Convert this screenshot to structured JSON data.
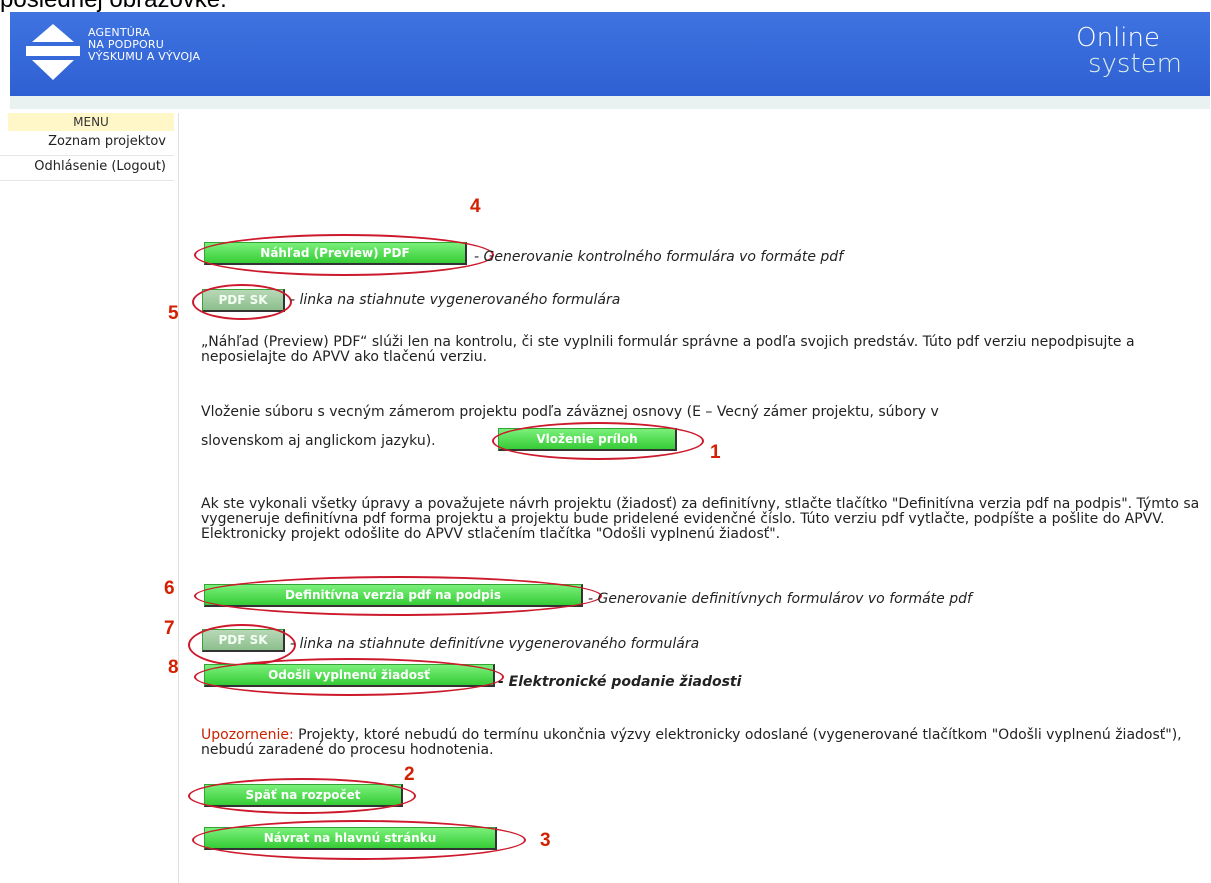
{
  "caption": "poslednej obrazovke.",
  "header": {
    "logo_lines": [
      "AGENTÚRA",
      "NA PODPORU",
      "VÝSKUMU A VÝVOJA"
    ],
    "brand_line1": "Online",
    "brand_line2": "system"
  },
  "sidebar": {
    "title": "MENU",
    "items": [
      {
        "label": "Zoznam projektov"
      },
      {
        "label": "Odhlásenie (Logout)"
      }
    ]
  },
  "buttons": {
    "preview_pdf": "Náhľad (Preview) PDF",
    "pdf_sk": "PDF SK",
    "upload_attachments": "Vloženie príloh",
    "final_pdf": "Definitívna verzia pdf na podpis",
    "pdf_sk_final": "PDF SK",
    "send_application": "Odošli vyplnenú žiadosť",
    "back_to_budget": "Späť na rozpočet",
    "return_home": "Návrat na hlavnú stránku"
  },
  "descriptions": {
    "preview_pdf": "- Generovanie kontrolného formulára vo formáte pdf",
    "pdf_sk": "- linka na stiahnute vygenerovaného formulára",
    "final_pdf": "- Generovanie definitívnych formulárov vo formáte pdf",
    "pdf_sk_final": "- linka na stiahnute definitívne vygenerovaného formulára",
    "send_application": "- Elektronické podanie žiadosti"
  },
  "paragraphs": {
    "preview_note": "„Náhľad (Preview) PDF“ slúži len na kontrolu, či ste vyplnili formulár správne a podľa svojich predstáv. Túto pdf verziu nepodpisujte a neposielajte do APVV ako tlačenú verziu.",
    "upload_line1": "Vloženie súboru s vecným zámerom projektu podľa záväznej osnovy (E – Vecný zámer projektu, súbory v",
    "upload_line2": "slovenskom aj anglickom jazyku).",
    "final_note": "Ak ste vykonali všetky úpravy a považujete návrh projektu (žiadosť) za definitívny, stlačte tlačítko \"Definitívna verzia pdf na podpis\". Týmto sa vygeneruje definitívna pdf forma projektu a projektu bude pridelené evidenčné číslo. Túto verziu pdf vytlačte, podpíšte a pošlite do APVV. Elektronicky projekt odošlite do APVV stlačením tlačítka \"Odošli vyplnenú žiadosť\".",
    "warning_label": "Upozornenie:",
    "warning_text": " Projekty, ktoré nebudú do termínu ukončnia výzvy elektronicky odoslané (vygenerované tlačítkom \"Odošli vyplnenú žiadosť\"), nebudú zaradené do procesu hodnotenia."
  },
  "annotations": {
    "n1": "1",
    "n2": "2",
    "n3": "3",
    "n4": "4",
    "n5": "5",
    "n6": "6",
    "n7": "7",
    "n8": "8"
  },
  "colors": {
    "header_blue": "#3e73e0",
    "button_green": "#36cc36",
    "annotation_red": "#cc1a2c",
    "warning_red": "#cc2200"
  }
}
